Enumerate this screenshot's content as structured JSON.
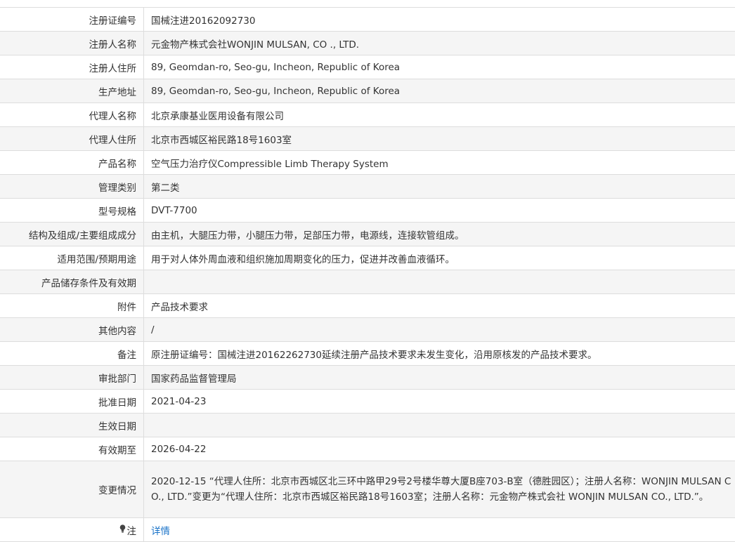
{
  "rows": [
    {
      "label": "注册证编号",
      "value": "国械注进20162092730"
    },
    {
      "label": "注册人名称",
      "value": "元金物产株式会社WONJIN MULSAN, CO ., LTD."
    },
    {
      "label": "注册人住所",
      "value": "89, Geomdan-ro, Seo-gu, Incheon, Republic of Korea"
    },
    {
      "label": "生产地址",
      "value": "89, Geomdan-ro, Seo-gu, Incheon, Republic of Korea"
    },
    {
      "label": "代理人名称",
      "value": "北京承康基业医用设备有限公司"
    },
    {
      "label": "代理人住所",
      "value": "北京市西城区裕民路18号1603室"
    },
    {
      "label": "产品名称",
      "value": "空气压力治疗仪Compressible Limb Therapy System"
    },
    {
      "label": "管理类别",
      "value": "第二类"
    },
    {
      "label": "型号规格",
      "value": "DVT-7700"
    },
    {
      "label": "结构及组成/主要组成成分",
      "value": "由主机，大腿压力带，小腿压力带，足部压力带，电源线，连接软管组成。"
    },
    {
      "label": "适用范围/预期用途",
      "value": "用于对人体外周血液和组织施加周期变化的压力，促进并改善血液循环。"
    },
    {
      "label": "产品储存条件及有效期",
      "value": ""
    },
    {
      "label": "附件",
      "value": "产品技术要求"
    },
    {
      "label": "其他内容",
      "value": "/"
    },
    {
      "label": "备注",
      "value": "原注册证编号：国械注进20162262730延续注册产品技术要求未发生变化，沿用原核发的产品技术要求。"
    },
    {
      "label": "审批部门",
      "value": "国家药品监督管理局"
    },
    {
      "label": "批准日期",
      "value": "2021-04-23"
    },
    {
      "label": "生效日期",
      "value": ""
    },
    {
      "label": "有效期至",
      "value": "2026-04-22"
    },
    {
      "label": "变更情况",
      "value": "2020-12-15 “代理人住所：北京市西城区北三环中路甲29号2号楼华尊大厦B座703-B室（德胜园区）；注册人名称：WONJIN MULSAN CO., LTD.”变更为“代理人住所：北京市西城区裕民路18号1603室；注册人名称：元金物产株式会社 WONJIN MULSAN CO., LTD.”。"
    }
  ],
  "note": {
    "label": "注",
    "icon": "lightbulb-icon",
    "link_text": "详情",
    "link_color": "#1a73c8"
  }
}
